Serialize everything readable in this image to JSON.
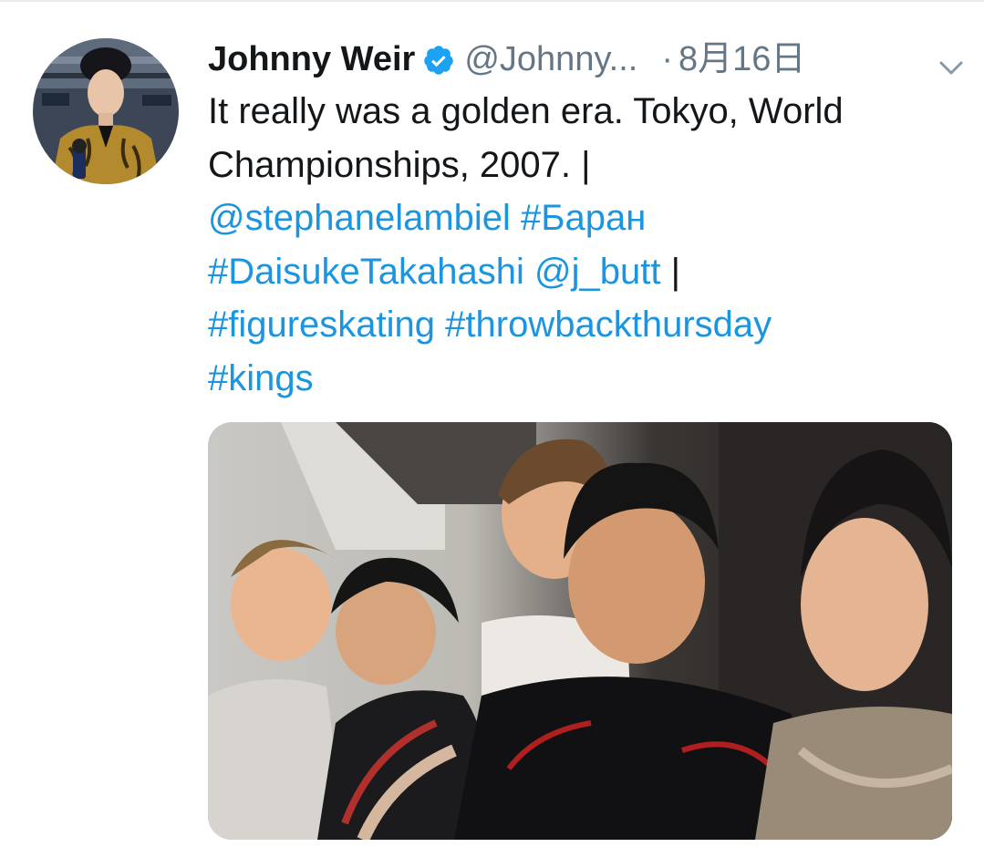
{
  "tweet": {
    "display_name": "Johnny Weir",
    "handle": "@Johnny...",
    "separator": "·",
    "date": "8月16日",
    "text_lines": [
      [
        {
          "t": "It really was a golden era. Tokyo, World",
          "link": false
        }
      ],
      [
        {
          "t": "Championships, 2007. |",
          "link": false
        }
      ],
      [
        {
          "t": "@stephanelambiel",
          "link": true
        },
        {
          "t": " ",
          "link": false
        },
        {
          "t": "#Баран",
          "link": true
        }
      ],
      [
        {
          "t": "#DaisukeTakahashi",
          "link": true
        },
        {
          "t": " ",
          "link": false
        },
        {
          "t": "@j_butt",
          "link": true
        },
        {
          "t": " |",
          "link": false
        }
      ],
      [
        {
          "t": "#figureskating",
          "link": true
        },
        {
          "t": " ",
          "link": false
        },
        {
          "t": "#throwbackthursday",
          "link": true
        }
      ],
      [
        {
          "t": "#kings",
          "link": true
        }
      ]
    ]
  },
  "icons": {
    "verified": "verified-badge-icon",
    "caret": "chevron-down-icon"
  },
  "colors": {
    "link": "#1b95e0",
    "verified": "#1da1f2",
    "secondary_text": "#657786",
    "primary_text": "#14171a"
  }
}
